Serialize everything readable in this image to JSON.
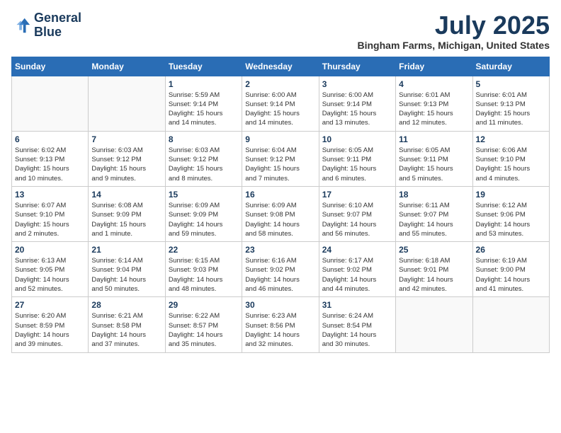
{
  "logo": {
    "line1": "General",
    "line2": "Blue"
  },
  "title": {
    "month_year": "July 2025",
    "location": "Bingham Farms, Michigan, United States"
  },
  "weekdays": [
    "Sunday",
    "Monday",
    "Tuesday",
    "Wednesday",
    "Thursday",
    "Friday",
    "Saturday"
  ],
  "weeks": [
    [
      {
        "day": "",
        "info": ""
      },
      {
        "day": "",
        "info": ""
      },
      {
        "day": "1",
        "info": "Sunrise: 5:59 AM\nSunset: 9:14 PM\nDaylight: 15 hours\nand 14 minutes."
      },
      {
        "day": "2",
        "info": "Sunrise: 6:00 AM\nSunset: 9:14 PM\nDaylight: 15 hours\nand 14 minutes."
      },
      {
        "day": "3",
        "info": "Sunrise: 6:00 AM\nSunset: 9:14 PM\nDaylight: 15 hours\nand 13 minutes."
      },
      {
        "day": "4",
        "info": "Sunrise: 6:01 AM\nSunset: 9:13 PM\nDaylight: 15 hours\nand 12 minutes."
      },
      {
        "day": "5",
        "info": "Sunrise: 6:01 AM\nSunset: 9:13 PM\nDaylight: 15 hours\nand 11 minutes."
      }
    ],
    [
      {
        "day": "6",
        "info": "Sunrise: 6:02 AM\nSunset: 9:13 PM\nDaylight: 15 hours\nand 10 minutes."
      },
      {
        "day": "7",
        "info": "Sunrise: 6:03 AM\nSunset: 9:12 PM\nDaylight: 15 hours\nand 9 minutes."
      },
      {
        "day": "8",
        "info": "Sunrise: 6:03 AM\nSunset: 9:12 PM\nDaylight: 15 hours\nand 8 minutes."
      },
      {
        "day": "9",
        "info": "Sunrise: 6:04 AM\nSunset: 9:12 PM\nDaylight: 15 hours\nand 7 minutes."
      },
      {
        "day": "10",
        "info": "Sunrise: 6:05 AM\nSunset: 9:11 PM\nDaylight: 15 hours\nand 6 minutes."
      },
      {
        "day": "11",
        "info": "Sunrise: 6:05 AM\nSunset: 9:11 PM\nDaylight: 15 hours\nand 5 minutes."
      },
      {
        "day": "12",
        "info": "Sunrise: 6:06 AM\nSunset: 9:10 PM\nDaylight: 15 hours\nand 4 minutes."
      }
    ],
    [
      {
        "day": "13",
        "info": "Sunrise: 6:07 AM\nSunset: 9:10 PM\nDaylight: 15 hours\nand 2 minutes."
      },
      {
        "day": "14",
        "info": "Sunrise: 6:08 AM\nSunset: 9:09 PM\nDaylight: 15 hours\nand 1 minute."
      },
      {
        "day": "15",
        "info": "Sunrise: 6:09 AM\nSunset: 9:09 PM\nDaylight: 14 hours\nand 59 minutes."
      },
      {
        "day": "16",
        "info": "Sunrise: 6:09 AM\nSunset: 9:08 PM\nDaylight: 14 hours\nand 58 minutes."
      },
      {
        "day": "17",
        "info": "Sunrise: 6:10 AM\nSunset: 9:07 PM\nDaylight: 14 hours\nand 56 minutes."
      },
      {
        "day": "18",
        "info": "Sunrise: 6:11 AM\nSunset: 9:07 PM\nDaylight: 14 hours\nand 55 minutes."
      },
      {
        "day": "19",
        "info": "Sunrise: 6:12 AM\nSunset: 9:06 PM\nDaylight: 14 hours\nand 53 minutes."
      }
    ],
    [
      {
        "day": "20",
        "info": "Sunrise: 6:13 AM\nSunset: 9:05 PM\nDaylight: 14 hours\nand 52 minutes."
      },
      {
        "day": "21",
        "info": "Sunrise: 6:14 AM\nSunset: 9:04 PM\nDaylight: 14 hours\nand 50 minutes."
      },
      {
        "day": "22",
        "info": "Sunrise: 6:15 AM\nSunset: 9:03 PM\nDaylight: 14 hours\nand 48 minutes."
      },
      {
        "day": "23",
        "info": "Sunrise: 6:16 AM\nSunset: 9:02 PM\nDaylight: 14 hours\nand 46 minutes."
      },
      {
        "day": "24",
        "info": "Sunrise: 6:17 AM\nSunset: 9:02 PM\nDaylight: 14 hours\nand 44 minutes."
      },
      {
        "day": "25",
        "info": "Sunrise: 6:18 AM\nSunset: 9:01 PM\nDaylight: 14 hours\nand 42 minutes."
      },
      {
        "day": "26",
        "info": "Sunrise: 6:19 AM\nSunset: 9:00 PM\nDaylight: 14 hours\nand 41 minutes."
      }
    ],
    [
      {
        "day": "27",
        "info": "Sunrise: 6:20 AM\nSunset: 8:59 PM\nDaylight: 14 hours\nand 39 minutes."
      },
      {
        "day": "28",
        "info": "Sunrise: 6:21 AM\nSunset: 8:58 PM\nDaylight: 14 hours\nand 37 minutes."
      },
      {
        "day": "29",
        "info": "Sunrise: 6:22 AM\nSunset: 8:57 PM\nDaylight: 14 hours\nand 35 minutes."
      },
      {
        "day": "30",
        "info": "Sunrise: 6:23 AM\nSunset: 8:56 PM\nDaylight: 14 hours\nand 32 minutes."
      },
      {
        "day": "31",
        "info": "Sunrise: 6:24 AM\nSunset: 8:54 PM\nDaylight: 14 hours\nand 30 minutes."
      },
      {
        "day": "",
        "info": ""
      },
      {
        "day": "",
        "info": ""
      }
    ]
  ]
}
